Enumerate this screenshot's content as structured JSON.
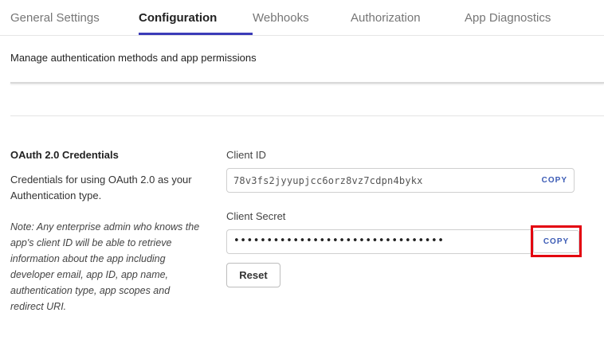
{
  "tabs": [
    {
      "label": "General Settings"
    },
    {
      "label": "Configuration"
    },
    {
      "label": "Webhooks"
    },
    {
      "label": "Authorization"
    },
    {
      "label": "App Diagnostics"
    }
  ],
  "active_tab": "Configuration",
  "subtitle": "Manage authentication methods and app permissions",
  "oauth": {
    "title": "OAuth 2.0 Credentials",
    "description": "Credentials for using OAuth 2.0 as your Authentication type.",
    "note": "Note: Any enterprise admin who knows the app's client ID will be able to retrieve information about the app including developer email, app ID, app name, authentication type, app scopes and redirect URI.",
    "client_id": {
      "label": "Client ID",
      "value": "78v3fs2jyyupjcc6orz8vz7cdpn4bykx",
      "copy_label": "COPY"
    },
    "client_secret": {
      "label": "Client Secret",
      "value": "••••••••••••••••••••••••••••••••",
      "copy_label": "COPY"
    },
    "reset_label": "Reset"
  },
  "colors": {
    "accent": "#3b3bb8",
    "copy_link": "#3b5bb5",
    "highlight": "#e3000f"
  }
}
